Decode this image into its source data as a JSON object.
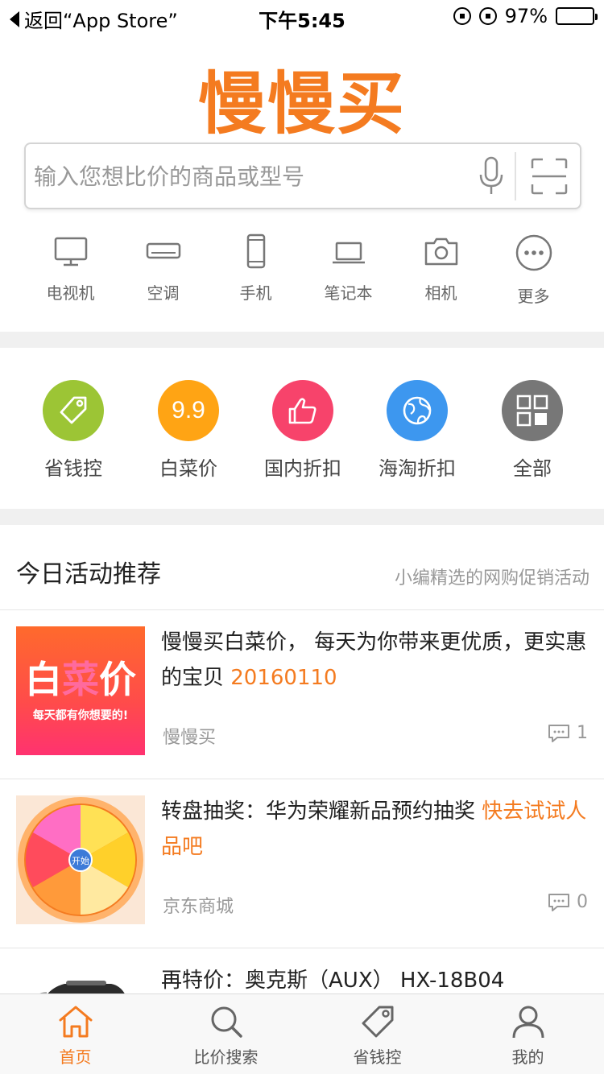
{
  "status_bar": {
    "back_label": "返回“App Store”",
    "time": "下午5:45",
    "battery_text": "97%",
    "battery_level": 0.97
  },
  "header": {
    "logo_text": "慢慢买"
  },
  "search": {
    "placeholder": "输入您想比价的商品或型号",
    "icons": [
      "mic-icon",
      "scan-icon"
    ]
  },
  "categories": [
    {
      "label": "电视机",
      "icon": "tv-icon"
    },
    {
      "label": "空调",
      "icon": "air-conditioner-icon"
    },
    {
      "label": "手机",
      "icon": "phone-icon"
    },
    {
      "label": "笔记本",
      "icon": "laptop-icon"
    },
    {
      "label": "相机",
      "icon": "camera-icon"
    },
    {
      "label": "更多",
      "icon": "more-icon"
    }
  ],
  "shortcuts": [
    {
      "label": "省钱控",
      "icon": "tag-icon",
      "color": "#9cc535"
    },
    {
      "label": "白菜价",
      "icon": "nine-point-nine-icon",
      "icon_text": "9.9",
      "color": "#ffa414"
    },
    {
      "label": "国内折扣",
      "icon": "thumbs-up-icon",
      "color": "#f7436b"
    },
    {
      "label": "海淘折扣",
      "icon": "globe-icon",
      "color": "#3d97ef"
    },
    {
      "label": "全部",
      "icon": "grid-icon",
      "color": "#777777"
    }
  ],
  "activity": {
    "title": "今日活动推荐",
    "subtitle": "小编精选的网购促销活动",
    "items": [
      {
        "title": "慢慢买白菜价， 每天为你带来更优质，更实惠的宝贝 ",
        "highlight": "20160110",
        "source": "慢慢买",
        "comments": "1",
        "thumb_big": "白菜价",
        "thumb_small": "每天都有你想要的!"
      },
      {
        "title": "转盘抽奖：华为荣耀新品预约抽奖 ",
        "highlight": "快去试试人品吧",
        "source": "京东商城",
        "comments": "0",
        "thumb_center": "开始"
      },
      {
        "title": "再特价：奥克斯（AUX） HX-18B04",
        "highlight": "",
        "source": "",
        "comments": ""
      }
    ]
  },
  "tabbar": {
    "tabs": [
      {
        "label": "首页",
        "icon": "home-icon",
        "active": true
      },
      {
        "label": "比价搜索",
        "icon": "search-icon",
        "active": false
      },
      {
        "label": "省钱控",
        "icon": "tag-icon",
        "active": false
      },
      {
        "label": "我的",
        "icon": "user-icon",
        "active": false
      }
    ]
  },
  "colors": {
    "brand": "#f47b20",
    "muted": "#999999",
    "separator": "#f0f0f0"
  }
}
